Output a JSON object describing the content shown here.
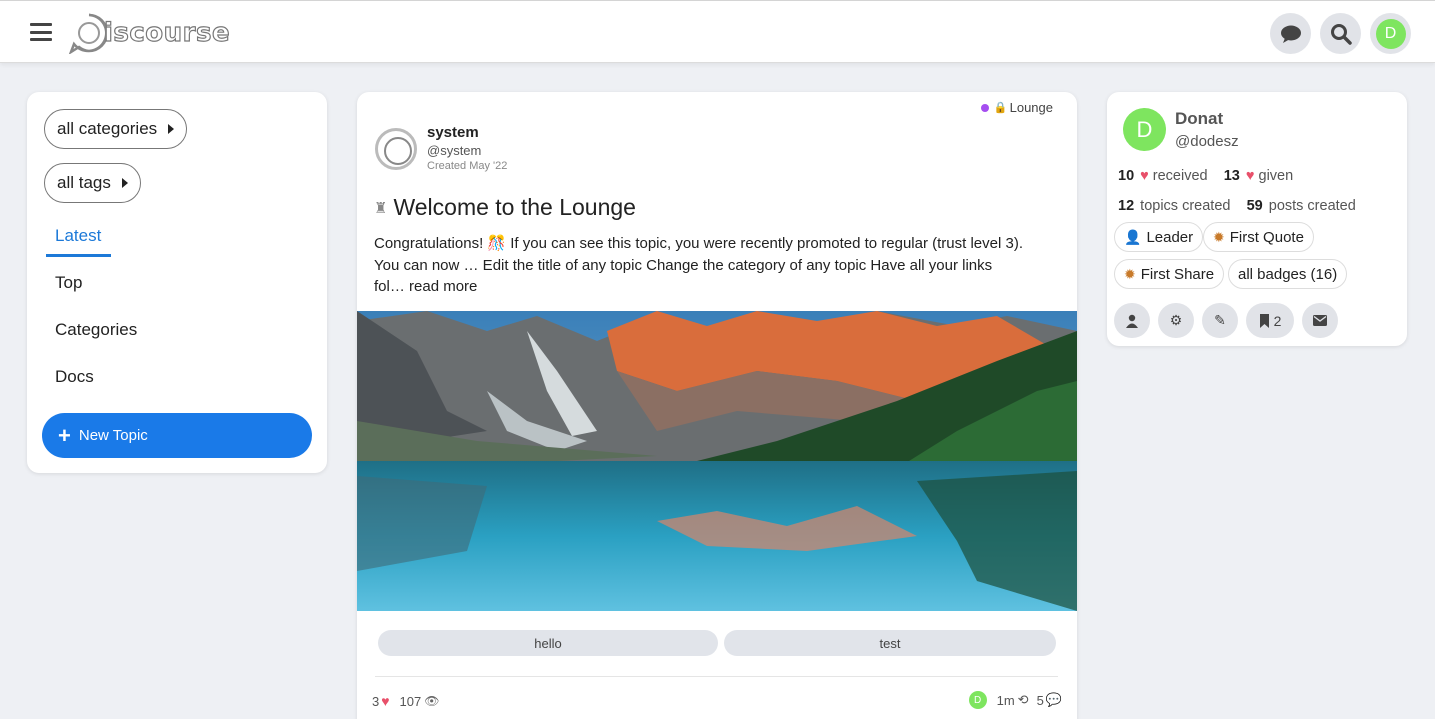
{
  "header": {
    "logo_text": "iscourse",
    "icons": [
      "menu-icon",
      "chat-icon",
      "search-icon",
      "user-avatar"
    ],
    "avatar_letter": "D"
  },
  "sidebar": {
    "filters": [
      {
        "label": "all categories"
      },
      {
        "label": "all tags"
      }
    ],
    "nav": [
      {
        "label": "Latest",
        "active": true
      },
      {
        "label": "Top"
      },
      {
        "label": "Categories"
      },
      {
        "label": "Docs"
      }
    ],
    "new_topic": "New Topic"
  },
  "topic": {
    "category": "Lounge",
    "category_color": "#a54ef0",
    "author_name": "system",
    "author_handle": "@system",
    "created": "Created May '22",
    "title": "Welcome to the Lounge",
    "excerpt": "Congratulations! 🎊 If you can see this topic, you were recently promoted to regular (trust level 3). You can now … Edit the title of any topic Change the category of any topic Have all your links fol…",
    "read_more": "read more",
    "tags": [
      "hello",
      "test"
    ],
    "likes": "3",
    "views": "107",
    "last_poster_letter": "D",
    "activity": "1m",
    "replies": "5"
  },
  "user_card": {
    "avatar_letter": "D",
    "name": "Donat",
    "handle": "@dodesz",
    "likes_received": "10",
    "likes_received_label": "received",
    "likes_given": "13",
    "likes_given_label": "given",
    "topics_created": "12",
    "topics_created_label": "topics created",
    "posts_created": "59",
    "posts_created_label": "posts created",
    "badges": [
      "Leader",
      "First Quote",
      "First Share",
      "all badges (16)"
    ],
    "bookmarks_count": "2"
  }
}
